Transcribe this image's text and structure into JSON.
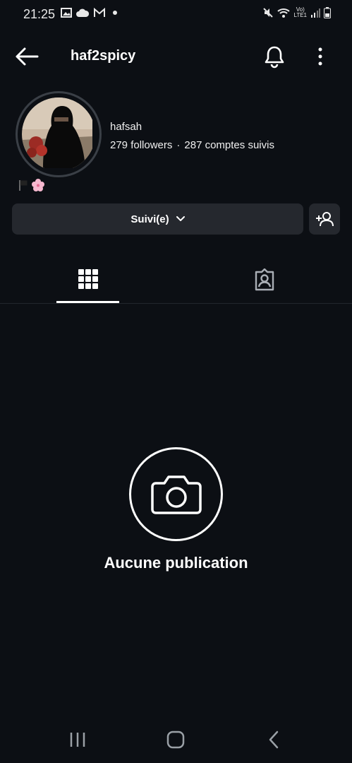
{
  "status_bar": {
    "time": "21:25",
    "left_icons": [
      "image-icon",
      "cloud-icon",
      "gmail-icon",
      "dot-icon"
    ],
    "right_icons": [
      "mute-icon",
      "wifi-icon",
      "lte-icon",
      "signal-icon",
      "battery-icon"
    ],
    "lte_top": "Vo)",
    "lte_bottom": "LTE1"
  },
  "header": {
    "username": "haf2spicy"
  },
  "profile": {
    "display_name": "hafsah",
    "followers": "279 followers",
    "separator": "·",
    "following": "287 comptes suivis",
    "bio_emojis": [
      "flag-icon",
      "cherry-blossom-icon"
    ]
  },
  "actions": {
    "follow_label": "Suivi(e)"
  },
  "tabs": [
    "grid",
    "tagged"
  ],
  "empty_state": {
    "message": "Aucune publication"
  },
  "colors": {
    "background": "#0c0f14",
    "button": "#25282e",
    "text": "#ffffff"
  }
}
